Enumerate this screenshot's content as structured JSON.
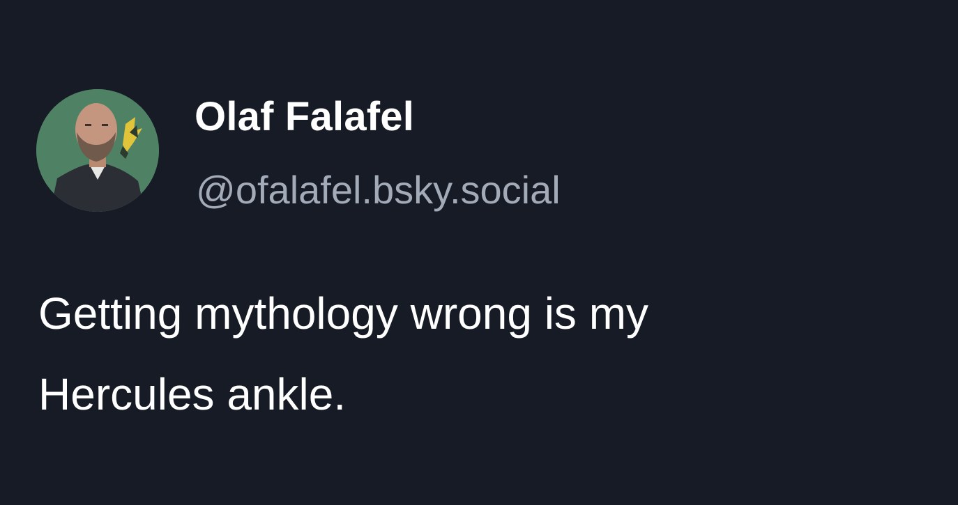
{
  "post": {
    "author": {
      "display_name": "Olaf Falafel",
      "handle": "@ofalafel.bsky.social",
      "avatar": "user-avatar-photo"
    },
    "text": "Getting mythology wrong is my\nHercules ankle."
  },
  "colors": {
    "background": "#161b26",
    "name_text": "#ffffff",
    "handle_text": "#a4abb8",
    "body_text": "#ffffff"
  }
}
